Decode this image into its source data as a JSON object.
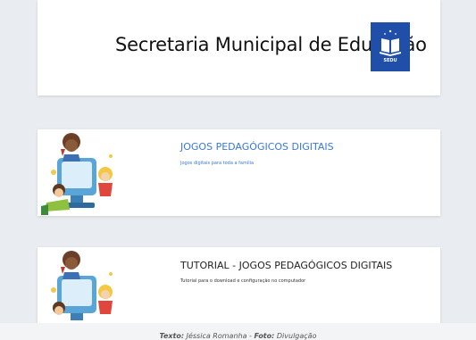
{
  "header": {
    "title": "Secretaria Municipal de Educação",
    "logo_text": "SEDU",
    "logo_color": "#1f4fa8"
  },
  "cards": [
    {
      "title": "JOGOS PEDAGÓGICOS DIGITAIS",
      "subtitle": "Jogos digitais para toda a família",
      "title_color": "#3878d8",
      "icon": "kids-computer-illustration"
    },
    {
      "title": "TUTORIAL - JOGOS PEDAGÓGICOS DIGITAIS",
      "subtitle": "Tutorial para o download e configuração no computador",
      "title_color": "#222222",
      "icon": "kids-computer-illustration"
    }
  ],
  "caption": {
    "text_label": "Texto:",
    "text_value": "Jéssica Romanha",
    "separator": " - ",
    "photo_label": "Foto:",
    "photo_value": "Divulgação"
  }
}
